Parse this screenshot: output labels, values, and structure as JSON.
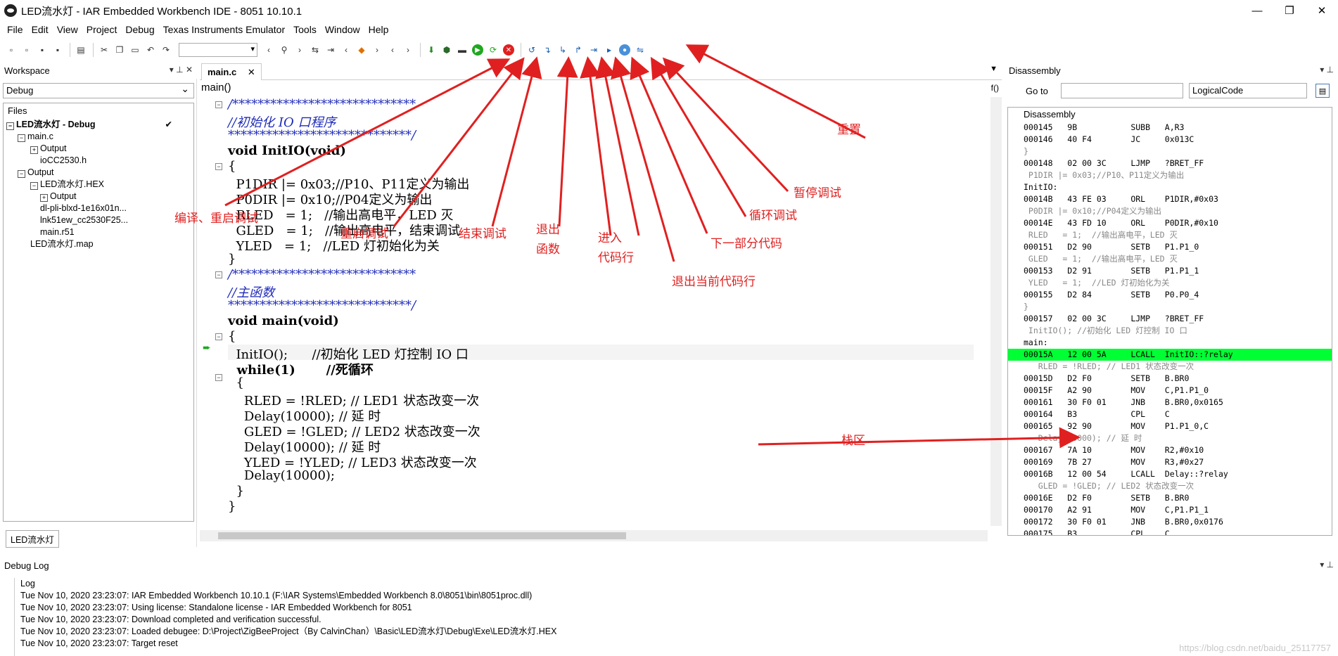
{
  "window": {
    "title": "LED流水灯 - IAR Embedded Workbench IDE - 8051 10.10.1",
    "minimize": "—",
    "maximize": "❐",
    "close": "✕"
  },
  "menu": [
    "File",
    "Edit",
    "View",
    "Project",
    "Debug",
    "Texas Instruments Emulator",
    "Tools",
    "Window",
    "Help"
  ],
  "workspace": {
    "title": "Workspace",
    "config": "Debug",
    "files_header": "Files",
    "tree": [
      {
        "label": "LED流水灯 - Debug",
        "bold": true
      },
      {
        "label": "main.c"
      },
      {
        "label": "Output"
      },
      {
        "label": "ioCC2530.h"
      },
      {
        "label": "Output"
      },
      {
        "label": "LED流水灯.HEX"
      },
      {
        "label": "Output"
      },
      {
        "label": "dl-pli-blxd-1e16x01n..."
      },
      {
        "label": "lnk51ew_cc2530F25..."
      },
      {
        "label": "main.r51"
      },
      {
        "label": "LED流水灯.map"
      }
    ],
    "bottom_tab": "LED流水灯"
  },
  "editor": {
    "tab": "main.c",
    "tab_close": "✕",
    "function": "main()",
    "lines": [
      "/*****************************",
      "//初始化 IO 口程序",
      "*****************************/",
      "void InitIO(void)",
      "{",
      "  P1DIR |= 0x03;//P10、P11定义为输出",
      "  P0DIR |= 0x10;//P04定义为输出",
      "  RLED   = 1;   //输出高电平，LED 灭",
      "  GLED   = 1;   //输出高电平，结束调试",
      "  YLED   = 1;   //LED 灯初始化为关",
      "}",
      "/*****************************",
      "//主函数",
      "*****************************/",
      "void main(void)",
      "{",
      "  InitIO();      //初始化 LED 灯控制 IO 口",
      "  while(1)       //死循环",
      "  {",
      "    RLED = !RLED; // LED1 状态改变一次",
      "    Delay(10000); // 延 时",
      "    GLED = !GLED; // LED2 状态改变一次",
      "    Delay(10000); // 延 时",
      "    YLED = !YLED; // LED3 状态改变一次",
      "    Delay(10000);",
      "  }",
      "}"
    ]
  },
  "disassembly": {
    "title": "Disassembly",
    "goto_label": "Go to",
    "mode": "LogicalCode",
    "list_header": "Disassembly",
    "rows": [
      "000145   9B           SUBB   A,R3",
      "000146   40 F4        JC     0x013C",
      "}",
      "000148   02 00 3C     LJMP   ?BRET_FF",
      " P1DIR |= 0x03;//P10、P11定义为输出",
      "InitIO:",
      "00014B   43 FE 03     ORL    P1DIR,#0x03",
      " P0DIR |= 0x10;//P04定义为输出",
      "00014E   43 FD 10     ORL    P0DIR,#0x10",
      " RLED   = 1;  //输出高电平，LED 灭",
      "000151   D2 90        SETB   P1.P1_0",
      " GLED   = 1;  //输出高电平，LED 灭",
      "000153   D2 91        SETB   P1.P1_1",
      " YLED   = 1;  //LED 灯初始化为关",
      "000155   D2 84        SETB   P0.P0_4",
      "}",
      "000157   02 00 3C     LJMP   ?BRET_FF",
      " InitIO(); //初始化 LED 灯控制 IO 口",
      "main:",
      "00015A   12 00 5A     LCALL  InitIO::?relay",
      "   RLED = !RLED; // LED1 状态改变一次",
      "00015D   D2 F0        SETB   B.BR0",
      "00015F   A2 90        MOV    C,P1.P1_0",
      "000161   30 F0 01     JNB    B.BR0,0x0165",
      "000164   B3           CPL    C",
      "000165   92 90        MOV    P1.P1_0,C",
      "   Delay(10000); // 延 时",
      "000167   7A 10        MOV    R2,#0x10",
      "000169   7B 27        MOV    R3,#0x27",
      "00016B   12 00 54     LCALL  Delay::?relay",
      "   GLED = !GLED; // LED2 状态改变一次",
      "00016E   D2 F0        SETB   B.BR0",
      "000170   A2 91        MOV    C,P1.P1_1",
      "000172   30 F0 01     JNB    B.BR0,0x0176",
      "000175   B3           CPL    C"
    ]
  },
  "debug_log": {
    "title": "Debug Log",
    "header": "Log",
    "entries": [
      "Tue Nov 10, 2020 23:23:07: IAR Embedded Workbench 10.10.1 (F:\\IAR Systems\\Embedded Workbench 8.0\\8051\\bin\\8051proc.dll)",
      "Tue Nov 10, 2020 23:23:07: Using license: Standalone license - IAR Embedded Workbench for 8051",
      "Tue Nov 10, 2020 23:23:07: Download completed and verification successful.",
      "Tue Nov 10, 2020 23:23:07: Loaded debugee: D:\\Project\\ZigBeeProject（By CalvinChan）\\Basic\\LED流水灯\\Debug\\Exe\\LED流水灯.HEX",
      "Tue Nov 10, 2020 23:23:07: Target reset"
    ]
  },
  "annotations": {
    "compile_restart": "编译、重启调试",
    "restart_debug": "重启调试",
    "stop_debug": "结束调试",
    "exit_func_1": "退出",
    "exit_func_2": "函数",
    "step_into_1": "进入",
    "step_into_2": "代码行",
    "step_out_line": "退出当前代码行",
    "next_part": "下一部分代码",
    "loop_debug": "循环调试",
    "pause_debug": "暂停调试",
    "reset": "重置",
    "stack": "栈区"
  },
  "watermark": "https://blog.csdn.net/baidu_25117757",
  "colors": {
    "annotation": "#e02020",
    "current_line": "#00ff33",
    "comment": "#1f2bb8",
    "number": "#0a7a1a"
  }
}
